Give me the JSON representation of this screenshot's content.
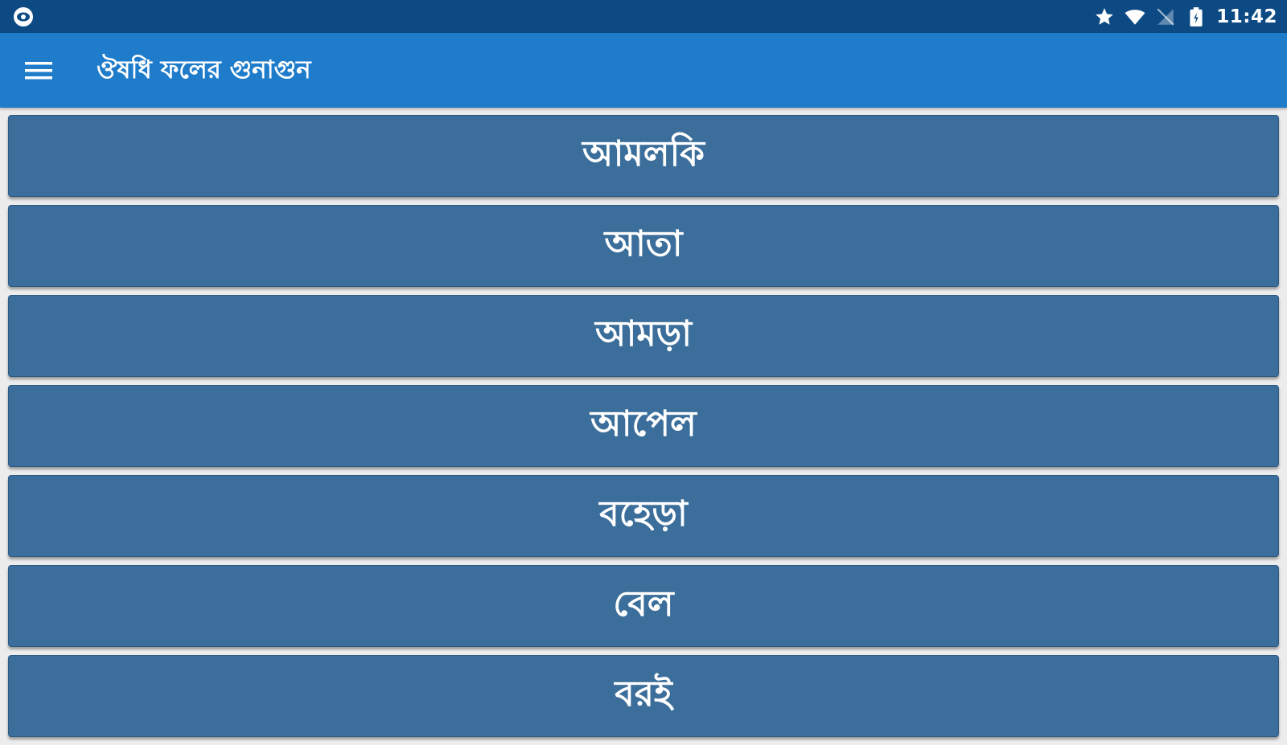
{
  "status_bar": {
    "left_icon": "eye-notification-icon",
    "icons": [
      "star-icon",
      "wifi-icon",
      "no-sim-icon",
      "battery-icon"
    ],
    "time": "11:42"
  },
  "app_bar": {
    "menu_icon": "menu-icon",
    "title": "ঔষধি ফলের গুনাগুন"
  },
  "fruits": [
    {
      "label": "আমলকি"
    },
    {
      "label": "আতা"
    },
    {
      "label": "আমড়া"
    },
    {
      "label": "আপেল"
    },
    {
      "label": "বহেড়া"
    },
    {
      "label": "বেল"
    },
    {
      "label": "বরই"
    }
  ],
  "colors": {
    "status_bar": "#0d4a84",
    "app_bar": "#1f7ccb",
    "list_item": "#3b6e9b",
    "background": "#ececec",
    "text": "#ffffff"
  }
}
